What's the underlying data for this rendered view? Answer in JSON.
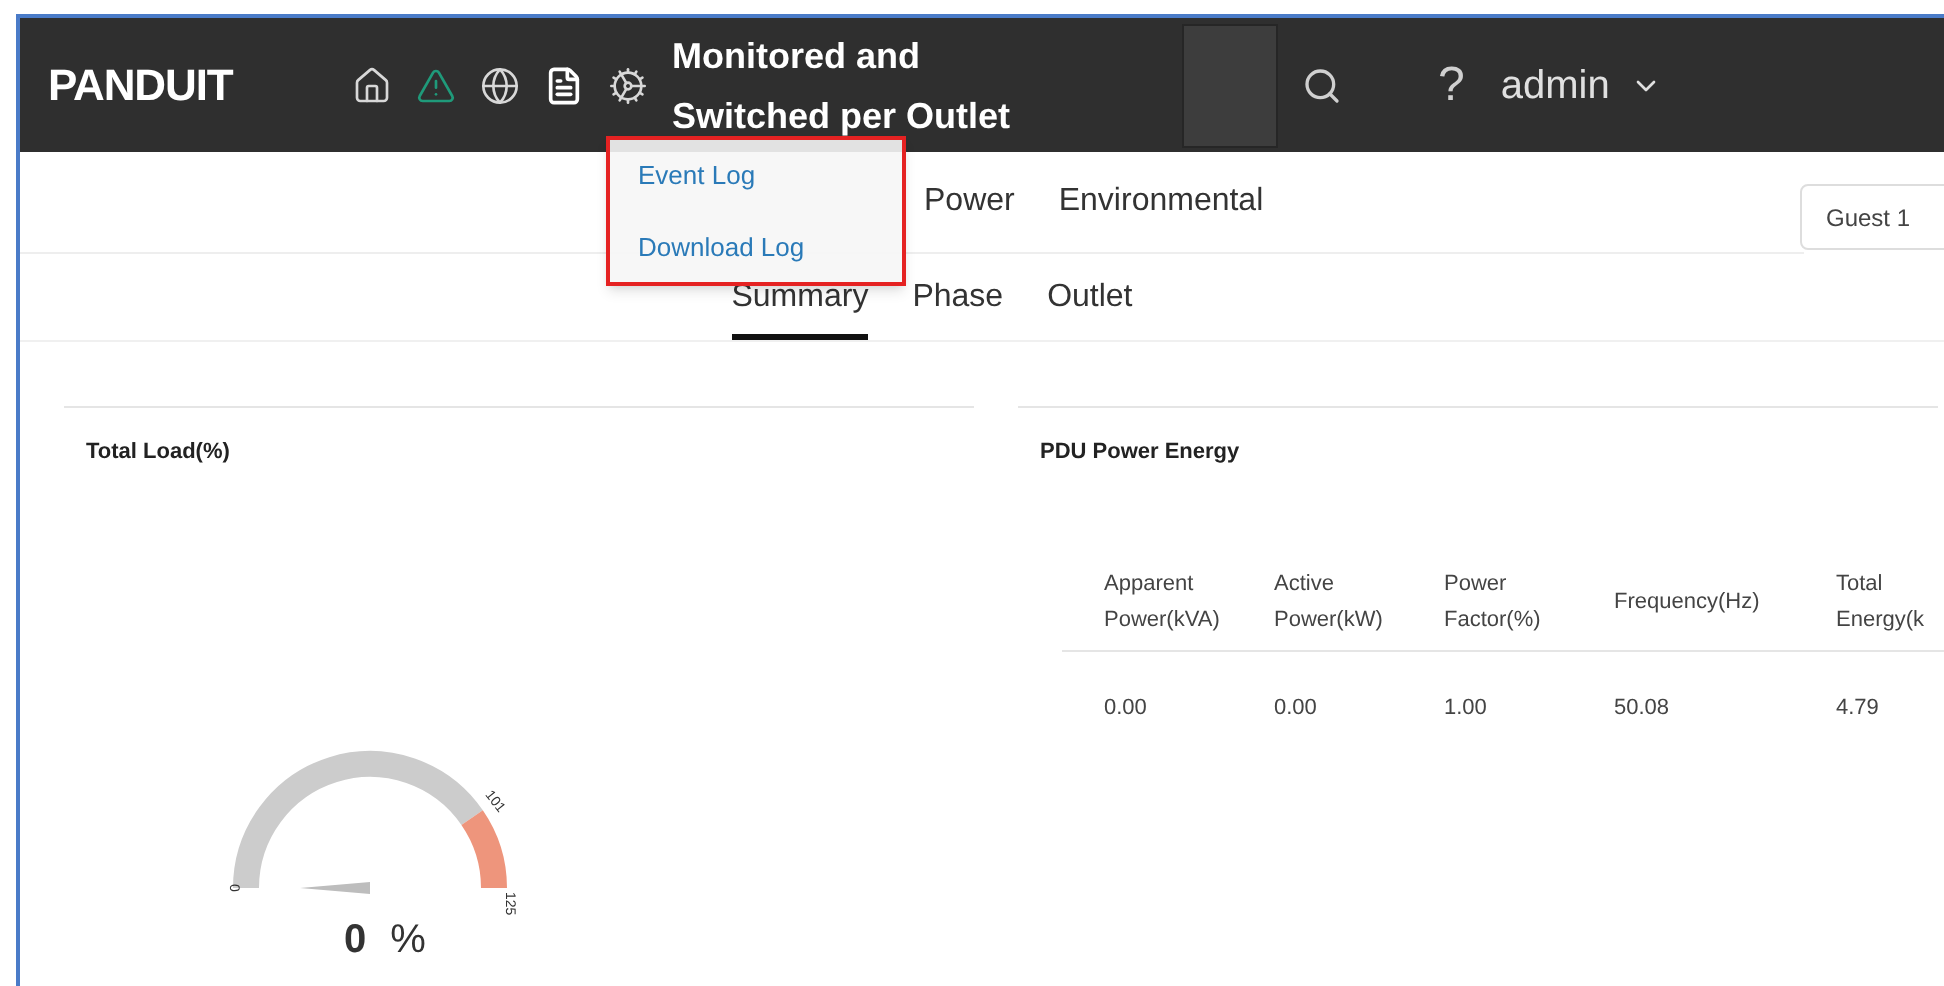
{
  "header": {
    "logo": "PANDUIT",
    "nav_icons": [
      {
        "kind": "home",
        "selected": false
      },
      {
        "kind": "warning",
        "selected": false
      },
      {
        "kind": "globe",
        "selected": false
      },
      {
        "kind": "document",
        "selected": true
      },
      {
        "kind": "gear",
        "selected": false
      }
    ],
    "title": "Monitored and Switched per Outlet",
    "help": "?",
    "user": "admin"
  },
  "dropdown": {
    "items": [
      "Event Log",
      "Download Log"
    ]
  },
  "top_tabs": [
    "Power",
    "Environmental"
  ],
  "guest_field": {
    "value": "Guest 1"
  },
  "sub_tabs": [
    {
      "label": "Summary",
      "selected": true
    },
    {
      "label": "Phase",
      "selected": false
    },
    {
      "label": "Outlet",
      "selected": false
    }
  ],
  "total_load": {
    "title": "Total Load(%)",
    "gauge": {
      "min_label": "0",
      "warn_label": "101",
      "max_label": "125",
      "value": "0",
      "unit": "%"
    }
  },
  "energy": {
    "title": "PDU Power Energy",
    "columns": [
      "Apparent Power(kVA)",
      "Active Power(kW)",
      "Power Factor(%)",
      "Frequency(Hz)",
      "Total Energy(k"
    ],
    "rows": [
      [
        "0.00",
        "0.00",
        "1.00",
        "50.08",
        "4.79"
      ]
    ]
  }
}
